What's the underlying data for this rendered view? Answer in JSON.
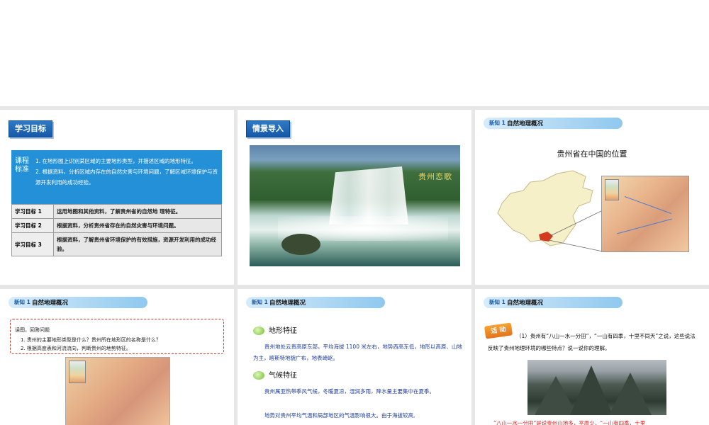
{
  "slide1": {
    "tag": "学习目标",
    "standard_head": "课程标准",
    "standard_items": [
      "1. 在地形图上识别某区域的主要地形类型，并描述区域的地形特征。",
      "2. 根据资料，分析区域内存在的自然灾害与环境问题，了解区域环境保护与资源开发利用的成功经验。"
    ],
    "goals": [
      {
        "key": "学习目标  1",
        "value": "运用地图和其他资料，了解贵州省的自然地  理特征。"
      },
      {
        "key": "学习目标  2",
        "value": "根据资料，分析贵州省存在的自然灾害与环境问题。"
      },
      {
        "key": "学习目标  3",
        "value": "根据资料，了解贵州省环境保护的有效措施，资源开发利用的成功经验。"
      }
    ]
  },
  "slide2": {
    "tag": "情景导入",
    "photo_title": "贵州恋歌"
  },
  "slide3": {
    "bar_prefix": "新知 1",
    "bar_label": "自然地理概况",
    "map_title": "贵州省在中国的位置"
  },
  "slide4": {
    "bar_prefix": "新知 1",
    "bar_label": "自然地理概况",
    "instruction": "读图，回答问题",
    "questions": [
      "1. 贵州的主要地形类型是什么？贵州所在地形区的名称是什么？",
      "2. 根据高度表和河流流向，判断贵州的地势特征。"
    ]
  },
  "slide5": {
    "bar_prefix": "新知 1",
    "bar_label": "自然地理概况",
    "section1_title": "地形特征",
    "section1_text": "贵州地处云贵高原东部，平均海拔 1100 米左右，地势西高东低，地形以高原、山地为主，喀斯特地貌广布，地表崎岖。",
    "section2_title": "气候特征",
    "section2_text": "贵州属亚热带季风气候，冬暖夏凉，湿润多雨，降水量主要集中在夏季。",
    "section2_text2": "地势对贵州平均气温和局部地区的气温影响很大。由于海拔较高,"
  },
  "slide6": {
    "bar_prefix": "新知 1",
    "bar_label": "自然地理概况",
    "activity_label": "活 动",
    "question": "（1）贵州有“八山一水一分田”，“一山有四季，十里不同天”之说，这些说法反映了贵州地理环境的哪些特点？说一说你的理解。",
    "answer_partial": "“八山一水一分田”是说贵州山地多，平原少。“一山有四季，十里"
  }
}
